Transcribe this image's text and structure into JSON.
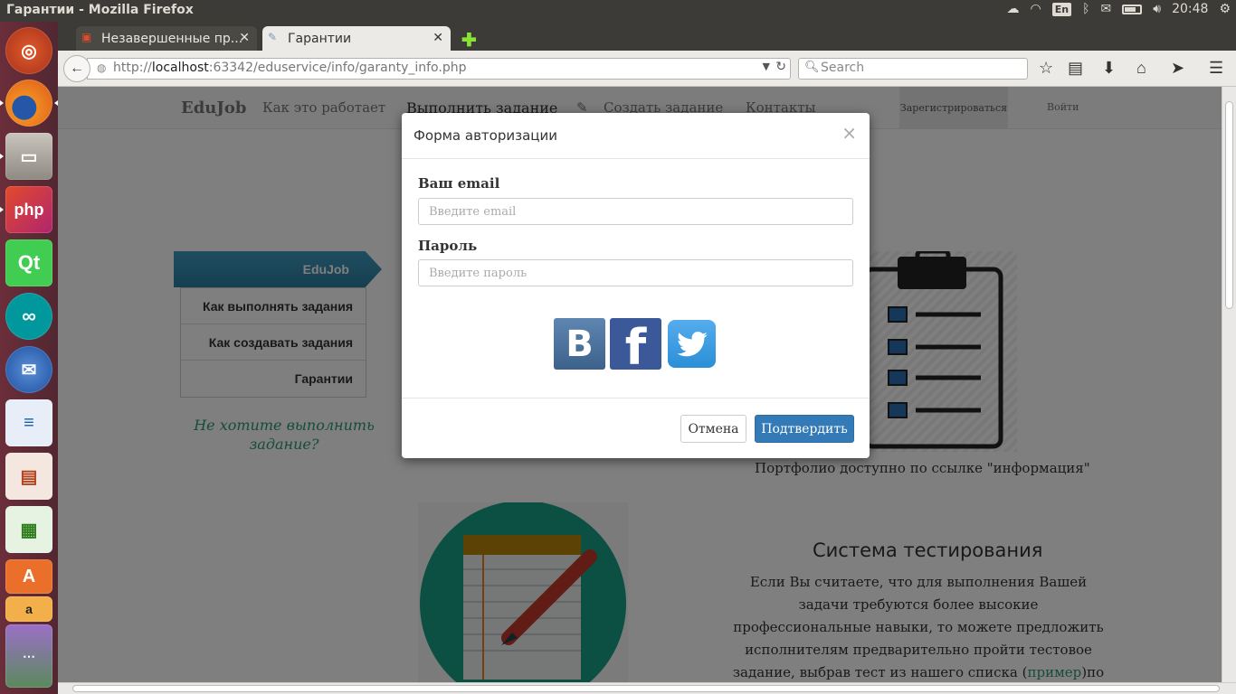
{
  "system": {
    "window_title": "Гарантии - Mozilla Firefox",
    "keyboard_layout": "En",
    "clock": "20:48"
  },
  "launcher": {
    "items": [
      "ubuntu-dash",
      "firefox",
      "files",
      "phpstorm",
      "qt-creator",
      "arduino",
      "thunderbird",
      "libreoffice-writer",
      "libreoffice-impress",
      "libreoffice-calc",
      "ubuntu-software",
      "amazon",
      "more-apps"
    ]
  },
  "browser": {
    "tabs": [
      {
        "label": "Незавершенные пр..."
      },
      {
        "label": "Гарантии"
      }
    ],
    "url_prefix": "http://",
    "url_host": "localhost",
    "url_rest": ":63342/eduservice/info/garanty_info.php",
    "search_placeholder": "Search"
  },
  "site": {
    "brand": "EduJob",
    "nav": {
      "how": "Как это работает",
      "do_task": "Выполнить задание",
      "create_task": "Создать задание",
      "contacts": "Контакты",
      "register": "Зарегистрироваться",
      "login": "Войти"
    },
    "sidebar": {
      "ribbon": "EduJob",
      "items": [
        {
          "label": "Как выполнять задания"
        },
        {
          "label": "Как создавать задания"
        },
        {
          "label": "Гарантии"
        }
      ],
      "cta": "Не хотите выполнить задание?"
    },
    "portfolio_text": "Портфолио доступно по ссылке \"информация\"",
    "testing": {
      "title": "Система тестирования",
      "text_before": "Если Вы считаете, что для выполнения Вашей задачи требуются более высокие профессиональные навыки, то можете предложить исполнителям предварительно пройти тестовое задание, выбрав тест из нашего списка (",
      "link": "пример",
      "text_after": ")по тематикам. Либо"
    }
  },
  "modal": {
    "title": "Форма авторизации",
    "close": "×",
    "email_label": "Ваш email",
    "email_placeholder": "Введите email",
    "password_label": "Пароль",
    "password_placeholder": "Введите пароль",
    "social": {
      "vk": "В",
      "fb": "f"
    },
    "cancel": "Отмена",
    "confirm": "Подтвердить"
  },
  "colors": {
    "accent_blue": "#337ab7",
    "ribbon": "#2a7fa3",
    "link_green": "#2a9a6f",
    "facebook": "#3b5998",
    "twitter": "#55acee"
  }
}
